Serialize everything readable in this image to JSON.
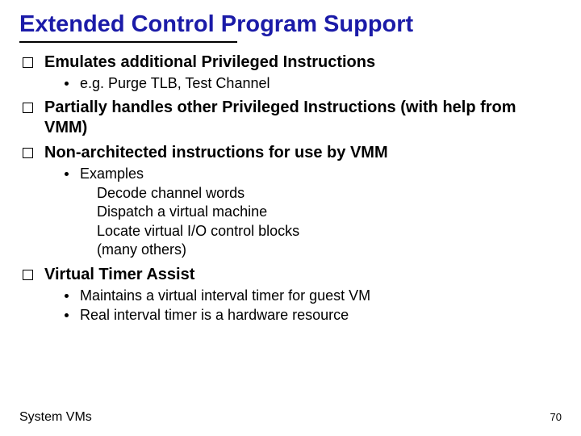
{
  "title": "Extended Control Program Support",
  "b1": {
    "text": "Emulates additional Privileged Instructions",
    "sub1": "e.g. Purge TLB, Test Channel"
  },
  "b2": {
    "text": "Partially handles other Privileged Instructions (with help from VMM)"
  },
  "b3": {
    "text": "Non-architected instructions for use by VMM",
    "sub1": "Examples",
    "ex1": "Decode channel words",
    "ex2": "Dispatch a virtual machine",
    "ex3": "Locate virtual I/O control blocks",
    "ex4": "(many others)"
  },
  "b4": {
    "text": "Virtual Timer Assist",
    "sub1": "Maintains a virtual interval timer for guest VM",
    "sub2": "Real interval timer is a hardware resource"
  },
  "footer": {
    "left": "System VMs",
    "page": "70"
  }
}
